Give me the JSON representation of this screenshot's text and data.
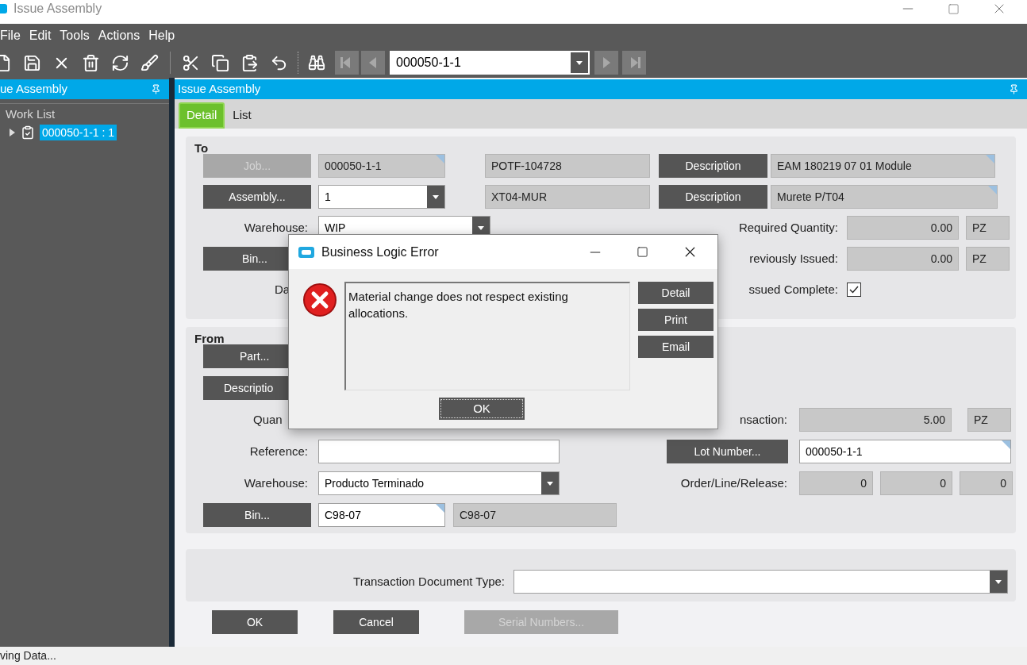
{
  "window": {
    "title": "Issue Assembly"
  },
  "menu": [
    "File",
    "Edit",
    "Tools",
    "Actions",
    "Help"
  ],
  "toolbar": {
    "record": "000050-1-1"
  },
  "left_panel": {
    "title": "ue Assembly",
    "tree": [
      {
        "label": "Work List",
        "children": [
          {
            "label": "000050-1-1 : 1",
            "selected": true,
            "expanded": false
          }
        ]
      }
    ]
  },
  "main_panel": {
    "title": "Issue Assembly"
  },
  "tabs": [
    {
      "label": "Detail",
      "selected": true
    },
    {
      "label": "List",
      "selected": false
    }
  ],
  "to": {
    "title": "To",
    "job_button": {
      "label": "Job...",
      "disabled": true
    },
    "job": {
      "value": "000050-1-1",
      "flag": true
    },
    "purchase_order": {
      "value": "POTF-104728",
      "flag": false
    },
    "description_button_1": {
      "label": "Description",
      "disabled": false
    },
    "description_1": {
      "value": "EAM 180219 07 01 Module",
      "flag": true
    },
    "assembly_button": {
      "label": "Assembly...",
      "disabled": false
    },
    "assembly": "1",
    "part": {
      "value": "XT04-MUR",
      "flag": false
    },
    "description_button_2": {
      "label": "Description",
      "disabled": false
    },
    "description_2": {
      "value": "Murete P/T04",
      "flag": true
    },
    "warehouse_label": "Warehouse:",
    "warehouse": "WIP",
    "required_quantity_label": "Required Quantity:",
    "required_quantity": "0.00",
    "required_uom": "PZ",
    "bin_button": {
      "label": "Bin...",
      "disabled": false
    },
    "previously_issued_label": "reviously Issued:",
    "previously_issued": "0.00",
    "previously_issued_uom": "PZ",
    "date_label": "Da",
    "issued_complete_label": "ssued Complete:",
    "issued_complete_checked": true
  },
  "from": {
    "title": "From",
    "part_button": {
      "label": "Part...",
      "disabled": false
    },
    "description_button": {
      "label": "Descriptio",
      "disabled": false
    },
    "quantity_label": "Quan",
    "transaction_label": "nsaction:",
    "transaction_quantity": "5.00",
    "transaction_uom": "PZ",
    "reference_label": "Reference:",
    "lot_button": {
      "label": "Lot Number...",
      "disabled": false
    },
    "lot": {
      "value": "000050-1-1",
      "flag": true
    },
    "warehouse_label": "Warehouse:",
    "warehouse": "Producto Terminado",
    "order_label": "Order/Line/Release:",
    "order_line_release": [
      "0",
      "0",
      "0"
    ],
    "bin_button": {
      "label": "Bin...",
      "disabled": false
    },
    "bin": {
      "value": "C98-07",
      "flag": true
    },
    "bin_description": {
      "value": "C98-07",
      "flag": false
    }
  },
  "footer": {
    "document_type_label": "Transaction Document Type:"
  },
  "actions": [
    {
      "label": "OK",
      "disabled": false
    },
    {
      "label": "Cancel",
      "disabled": false
    },
    {
      "label": "Serial Numbers...",
      "disabled": true
    }
  ],
  "dialog": {
    "title": "Business Logic Error",
    "message": "Material change does not respect existing allocations.",
    "buttons": [
      "Detail",
      "Print",
      "Email"
    ],
    "ok": "OK"
  },
  "status_bar": "ving Data..."
}
